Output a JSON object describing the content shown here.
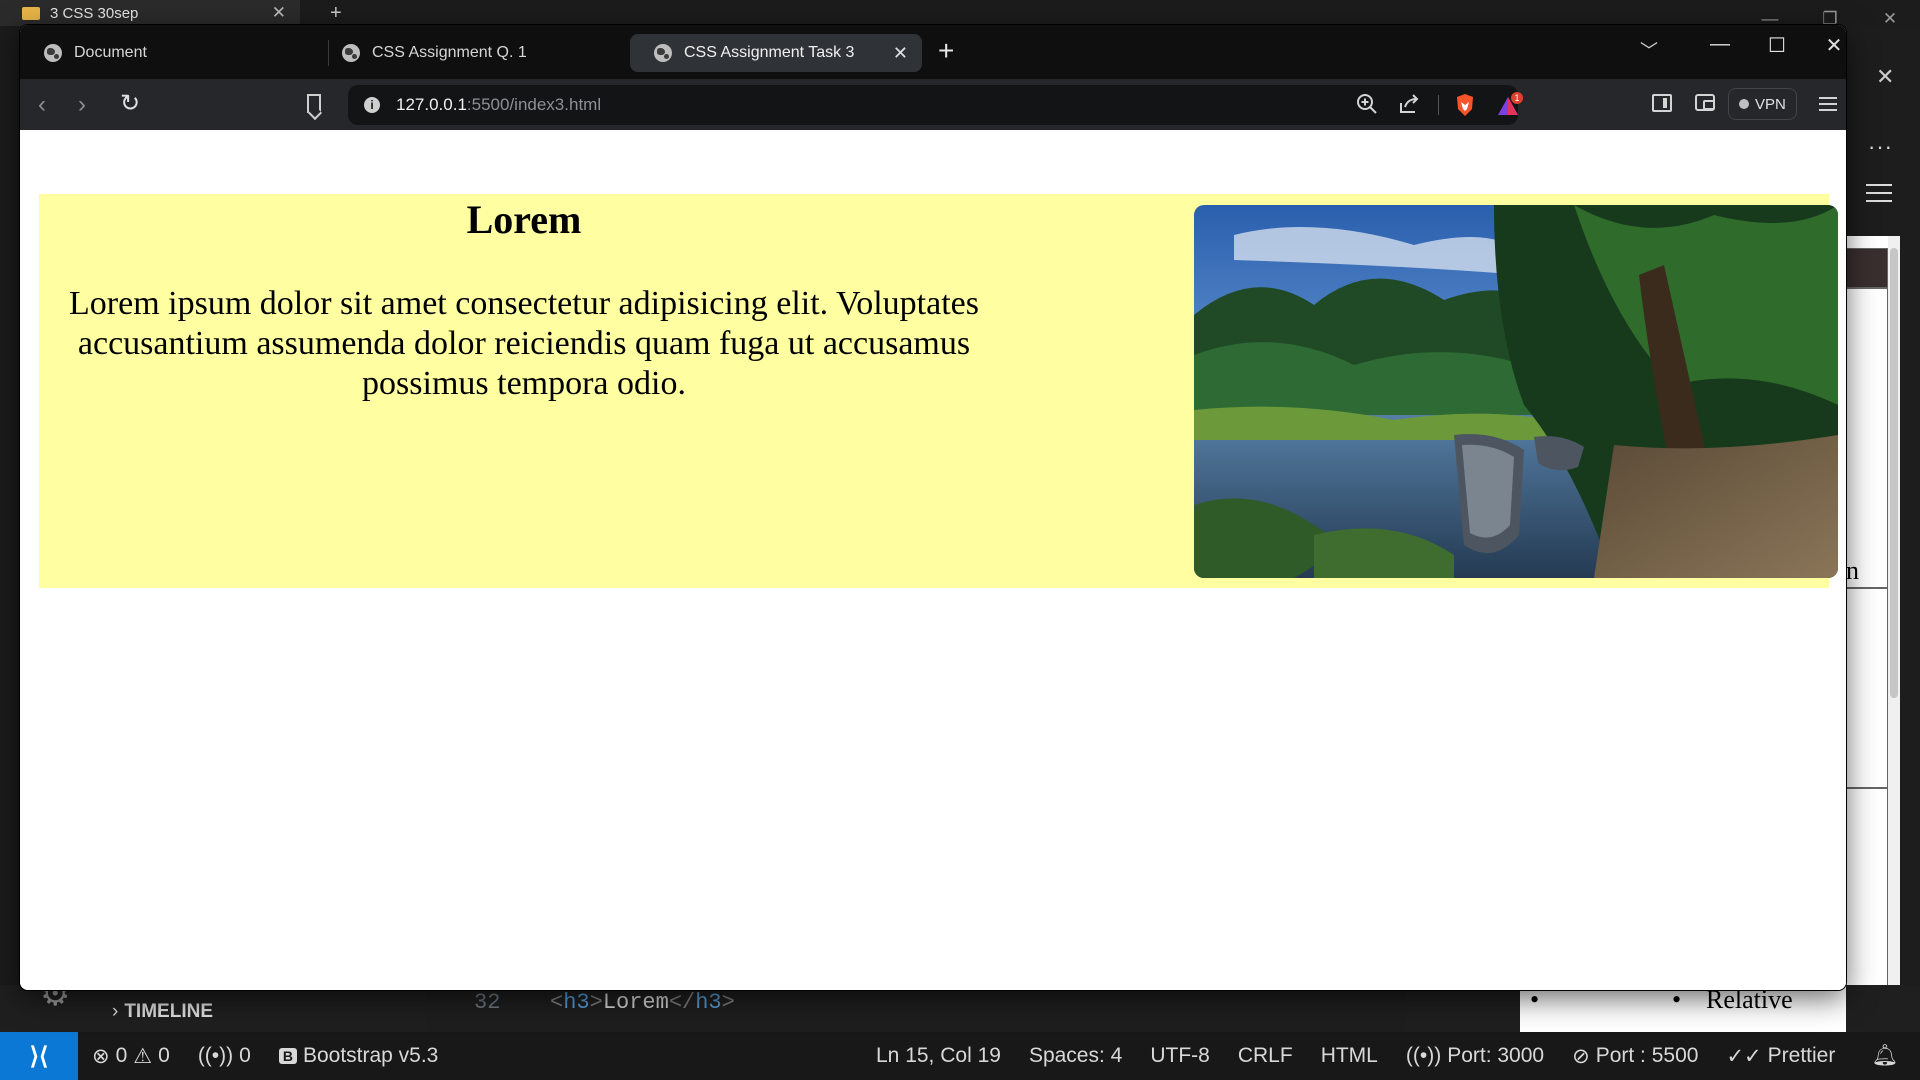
{
  "background": {
    "folder_tab": "3 CSS 30sep",
    "timeline_label": "TIMELINE",
    "code_line_number": "32",
    "code_tag_open": "h3",
    "code_text": "Lorem",
    "code_tag_close": "h3",
    "right_panel_bullet_text": "Relative",
    "right_panel_fragment": "n"
  },
  "status_bar": {
    "errors": "0",
    "warnings": "0",
    "ports_forwarded": "0",
    "bootstrap": "Bootstrap v5.3",
    "cursor": "Ln 15, Col 19",
    "spaces": "Spaces: 4",
    "encoding": "UTF-8",
    "eol": "CRLF",
    "language": "HTML",
    "port_a": "Port: 3000",
    "port_b": "Port : 5500",
    "prettier": "Prettier"
  },
  "browser": {
    "tabs": [
      {
        "label": "Document",
        "active": false
      },
      {
        "label": "CSS Assignment Q. 1",
        "active": false
      },
      {
        "label": "CSS Assignment Task 3",
        "active": true
      }
    ],
    "url_host": "127.0.0.1",
    "url_rest": ":5500/index3.html",
    "vpn_label": "VPN",
    "rewards_badge": "1"
  },
  "page": {
    "title": "Lorem",
    "paragraph": "Lorem ipsum dolor sit amet consectetur adipisicing elit. Voluptates accusantium assumenda dolor reiciendis quam fuga ut accusamus possimus tempora odio.",
    "background_color": "#ffffa2",
    "image_subject": "boats-on-river-photo"
  },
  "colors": {
    "accent_blue": "#0a78d4",
    "brave_orange": "#fb542b"
  }
}
